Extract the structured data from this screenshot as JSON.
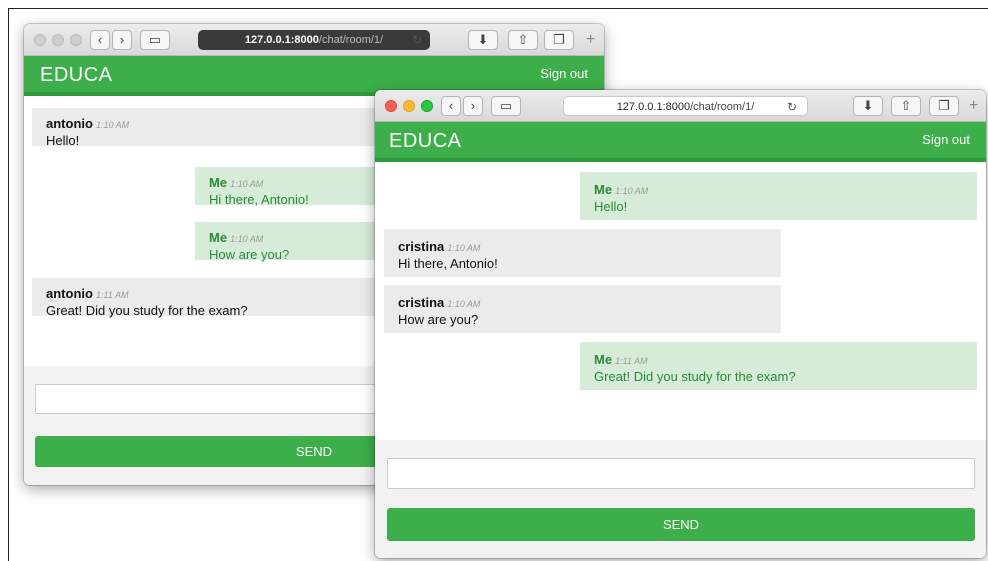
{
  "back_window": {
    "url_host": "127.0.0.1:8000",
    "url_path": "/chat/room/1/",
    "brand": "EDUCA",
    "sign_out": "Sign out",
    "messages": [
      {
        "sender": "antonio",
        "time": "1:10 AM",
        "text": "Hello!"
      },
      {
        "sender": "Me",
        "time": "1:10 AM",
        "text": "Hi there, Antonio!"
      },
      {
        "sender": "Me",
        "time": "1:10 AM",
        "text": "How are you?"
      },
      {
        "sender": "antonio",
        "time": "1:11 AM",
        "text": "Great! Did you study for the exam?"
      }
    ],
    "input_value": "",
    "send_label": "SEND"
  },
  "front_window": {
    "url_host": "127.0.0.1:8000",
    "url_path": "/chat/room/1/",
    "brand": "EDUCA",
    "sign_out": "Sign out",
    "messages": [
      {
        "sender": "Me",
        "time": "1:10 AM",
        "text": "Hello!"
      },
      {
        "sender": "cristina",
        "time": "1:10 AM",
        "text": "Hi there, Antonio!"
      },
      {
        "sender": "cristina",
        "time": "1:10 AM",
        "text": "How are you?"
      },
      {
        "sender": "Me",
        "time": "1:11 AM",
        "text": "Great! Did you study for the exam?"
      }
    ],
    "input_value": "",
    "send_label": "SEND"
  },
  "toolbar_glyphs": {
    "back": "‹",
    "forward": "›",
    "sidebar": "▭",
    "download": "⬇",
    "share": "⇧",
    "tabs": "❐",
    "reload": "↻",
    "new_tab": "+"
  },
  "colors": {
    "accent": "#3cae4a",
    "me_bubble": "#d6ecd8",
    "other_bubble": "#ebebeb"
  }
}
